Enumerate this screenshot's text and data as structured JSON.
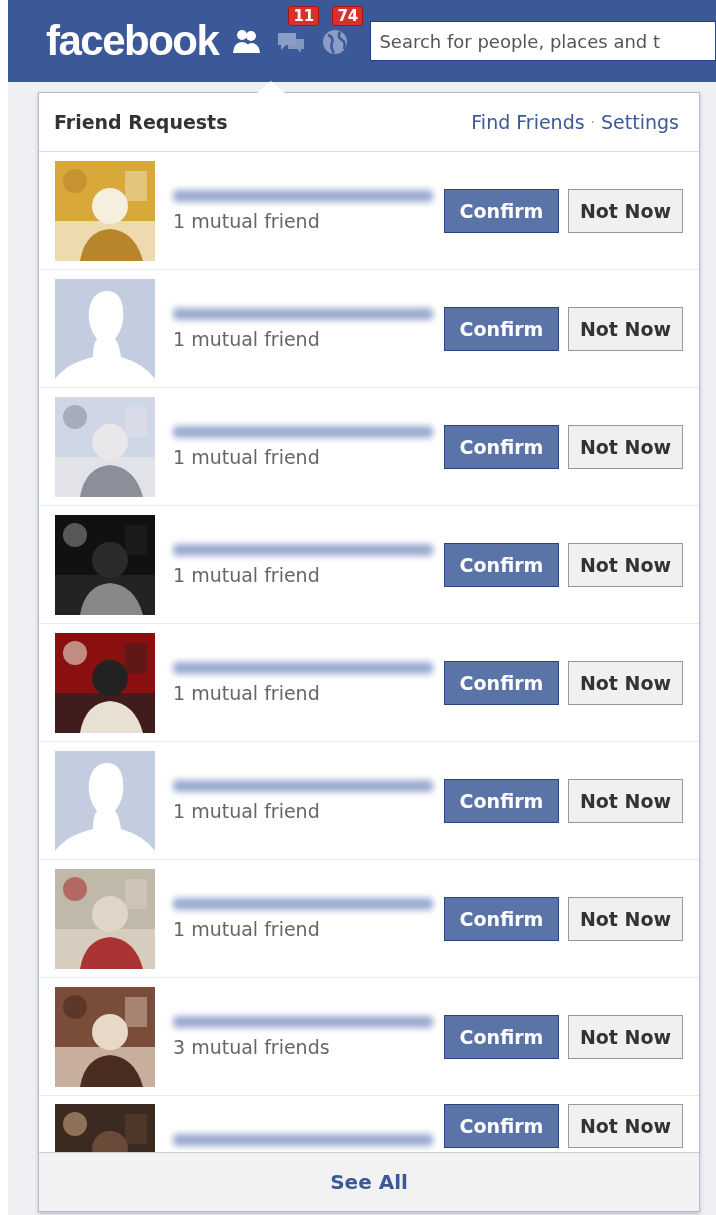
{
  "top_bar": {
    "logo": "facebook",
    "icons": [
      {
        "kind": "friends",
        "selected": true
      },
      {
        "kind": "messages",
        "badge": "11",
        "selected": false
      },
      {
        "kind": "notifications",
        "badge": "74",
        "selected": false
      }
    ],
    "search": {
      "placeholder": "Search for people, places and t"
    }
  },
  "dropdown": {
    "title": "Friend Requests",
    "links": [
      "Find Friends",
      "Settings"
    ],
    "separator": "·",
    "requests": [
      {
        "has_photo": true,
        "mutual": "1 mutual friend",
        "confirm": "Confirm",
        "not_now": "Not Now"
      },
      {
        "has_photo": false,
        "mutual": "1 mutual friend",
        "confirm": "Confirm",
        "not_now": "Not Now"
      },
      {
        "has_photo": true,
        "mutual": "1 mutual friend",
        "confirm": "Confirm",
        "not_now": "Not Now"
      },
      {
        "has_photo": true,
        "mutual": "1 mutual friend",
        "confirm": "Confirm",
        "not_now": "Not Now"
      },
      {
        "has_photo": true,
        "mutual": "1 mutual friend",
        "confirm": "Confirm",
        "not_now": "Not Now"
      },
      {
        "has_photo": false,
        "mutual": "1 mutual friend",
        "confirm": "Confirm",
        "not_now": "Not Now"
      },
      {
        "has_photo": true,
        "mutual": "1 mutual friend",
        "confirm": "Confirm",
        "not_now": "Not Now"
      },
      {
        "has_photo": true,
        "mutual": "3 mutual friends",
        "confirm": "Confirm",
        "not_now": "Not Now"
      },
      {
        "has_photo": true,
        "confirm": "Confirm",
        "not_now": "Not Now"
      }
    ],
    "footer": "See All"
  }
}
